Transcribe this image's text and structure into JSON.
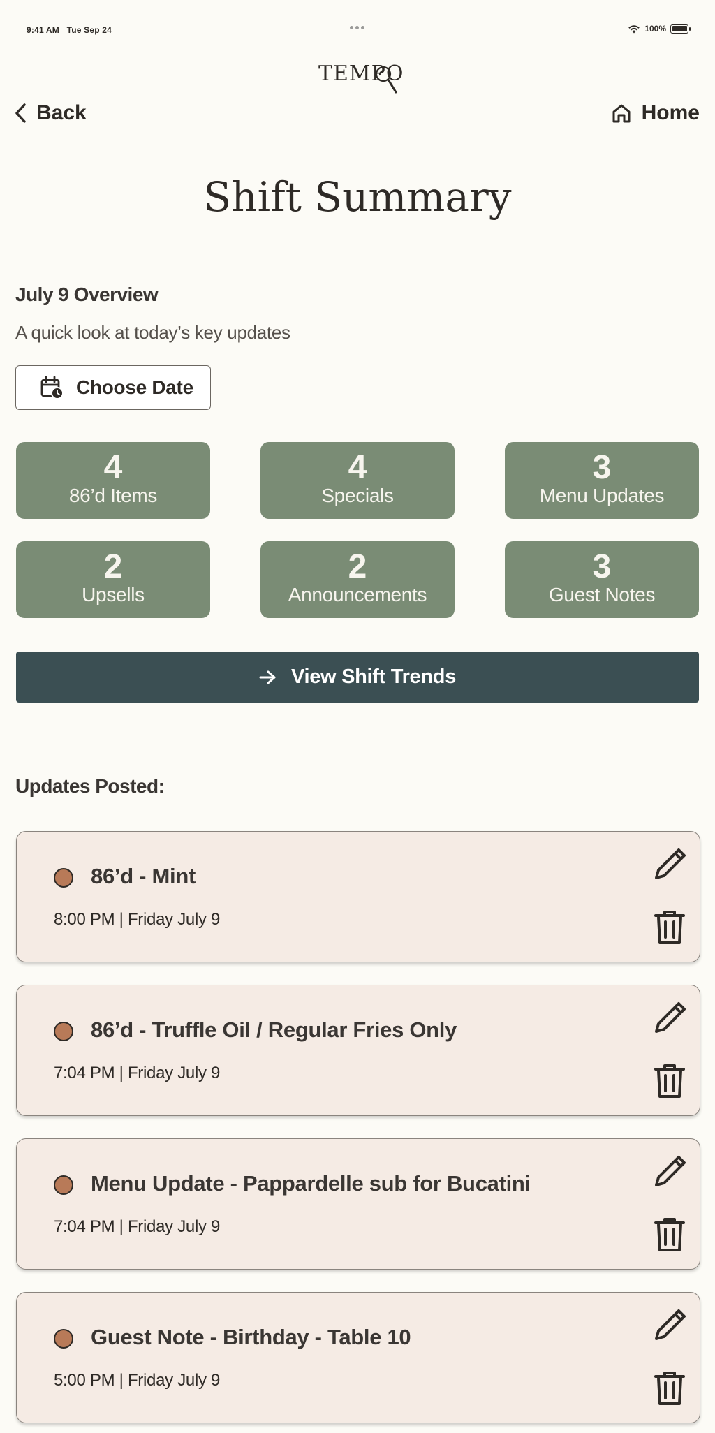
{
  "status_bar": {
    "time": "9:41 AM",
    "date": "Tue Sep 24",
    "battery": "100%",
    "icons": [
      "wifi-icon",
      "battery-icon"
    ]
  },
  "app": {
    "logo_text": "TEMPO"
  },
  "nav": {
    "back_label": "Back",
    "home_label": "Home"
  },
  "page_title": "Shift Summary",
  "overview": {
    "title": "July 9 Overview",
    "subtitle": "A quick look at today’s key updates",
    "choose_date_label": "Choose Date"
  },
  "stats": [
    {
      "value": "4",
      "label": "86’d Items"
    },
    {
      "value": "4",
      "label": "Specials"
    },
    {
      "value": "3",
      "label": "Menu Updates"
    },
    {
      "value": "2",
      "label": "Upsells"
    },
    {
      "value": "2",
      "label": "Announcements"
    },
    {
      "value": "3",
      "label": "Guest Notes"
    }
  ],
  "trends_button_label": "View Shift Trends",
  "updates_heading": "Updates Posted:",
  "updates": [
    {
      "title": "86’d - Mint",
      "time": "8:00 PM | Friday July 9"
    },
    {
      "title": "86’d - Truffle Oil / Regular Fries Only",
      "time": "7:04 PM | Friday July 9"
    },
    {
      "title": "Menu Update - Pappardelle sub for Bucatini",
      "time": "7:04 PM | Friday July 9"
    },
    {
      "title": "Guest Note - Birthday - Table 10",
      "time": "5:00 PM | Friday July 9"
    }
  ],
  "colors": {
    "background": "#FCFBF6",
    "stat_card": "#7A8C75",
    "trends_button": "#3B4F53",
    "update_card": "#F5EBE4",
    "update_dot": "#B87A58"
  }
}
